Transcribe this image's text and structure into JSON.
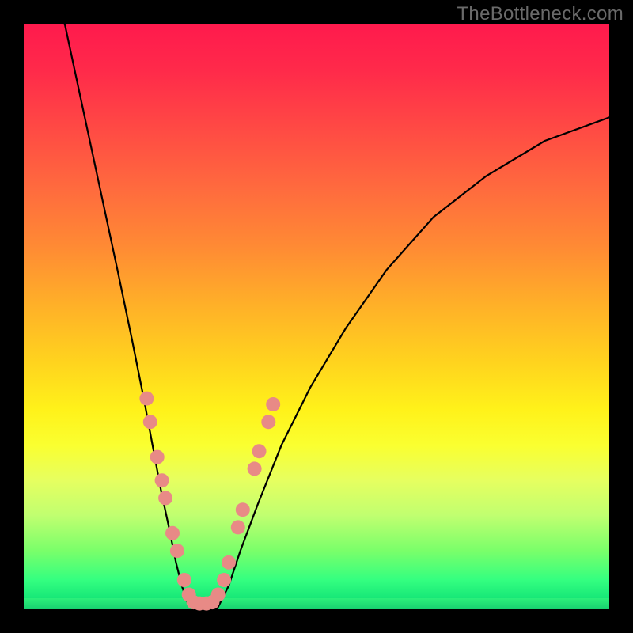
{
  "watermark": "TheBottleneck.com",
  "colors": {
    "frame": "#000000",
    "curve": "#000000",
    "dot_fill": "#e88a86",
    "dot_stroke": "#d07a76",
    "gradient_top": "#ff1a4d",
    "gradient_bottom": "#14d272"
  },
  "chart_data": {
    "type": "line",
    "title": "",
    "xlabel": "",
    "ylabel": "",
    "xlim": [
      0,
      100
    ],
    "ylim": [
      0,
      100
    ],
    "grid": false,
    "series": [
      {
        "name": "left-branch",
        "x": [
          7,
          10,
          13,
          16,
          18.5,
          20.5,
          22,
          23.5,
          24.8,
          26,
          27,
          28,
          29
        ],
        "y": [
          100,
          86,
          72,
          58,
          46,
          36,
          28,
          20,
          14,
          8,
          4,
          1,
          0
        ]
      },
      {
        "name": "right-branch",
        "x": [
          33,
          35,
          37,
          40,
          44,
          49,
          55,
          62,
          70,
          79,
          89,
          100
        ],
        "y": [
          0,
          4,
          10,
          18,
          28,
          38,
          48,
          58,
          67,
          74,
          80,
          84
        ]
      }
    ],
    "highlight_points": {
      "name": "scatter-dots",
      "description": "salmon-colored highlight dots along both branches near the valley",
      "points": [
        {
          "x": 21.0,
          "y": 36
        },
        {
          "x": 21.6,
          "y": 32
        },
        {
          "x": 22.8,
          "y": 26
        },
        {
          "x": 23.6,
          "y": 22
        },
        {
          "x": 24.2,
          "y": 19
        },
        {
          "x": 25.4,
          "y": 13
        },
        {
          "x": 26.2,
          "y": 10
        },
        {
          "x": 27.4,
          "y": 5
        },
        {
          "x": 28.2,
          "y": 2.5
        },
        {
          "x": 29.0,
          "y": 1.2
        },
        {
          "x": 30.0,
          "y": 1.0
        },
        {
          "x": 31.2,
          "y": 1.0
        },
        {
          "x": 32.2,
          "y": 1.2
        },
        {
          "x": 33.2,
          "y": 2.5
        },
        {
          "x": 34.2,
          "y": 5
        },
        {
          "x": 35.0,
          "y": 8
        },
        {
          "x": 36.6,
          "y": 14
        },
        {
          "x": 37.4,
          "y": 17
        },
        {
          "x": 39.4,
          "y": 24
        },
        {
          "x": 40.2,
          "y": 27
        },
        {
          "x": 41.8,
          "y": 32
        },
        {
          "x": 42.6,
          "y": 35
        }
      ]
    }
  }
}
